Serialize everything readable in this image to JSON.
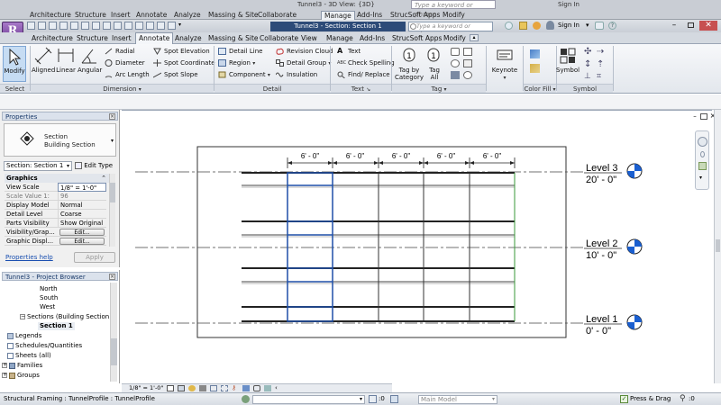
{
  "ghost": {
    "tabs": [
      "Architecture",
      "Structure",
      "Insert",
      "Annotate",
      "Analyze",
      "Massing & Site",
      "Collaborate",
      "Manage",
      "Add-Ins",
      "StrucSoft Apps",
      "Modify"
    ],
    "active_tab": "Manage",
    "title": "Tunnel3 - 3D View: {3D}",
    "search_placeholder": "Type a keyword or phrase",
    "sign_in": "Sign In"
  },
  "app": {
    "logo": "R",
    "title": "Tunnel3 - Section: Section 1",
    "search_placeholder": "Type a keyword or phrase",
    "sign_in": "Sign In"
  },
  "ribbon_tabs": [
    "Architecture",
    "Structure",
    "Insert",
    "Annotate",
    "Analyze",
    "Massing & Site",
    "Collaborate",
    "View",
    "Manage",
    "Add-Ins",
    "StrucSoft Apps",
    "Modify"
  ],
  "active_ribbon_tab": "Annotate",
  "ribbon": {
    "modify": "Modify",
    "aligned": "Aligned",
    "linear": "Linear",
    "angular": "Angular",
    "radial": "Radial",
    "diameter": "Diameter",
    "arc_length": "Arc Length",
    "spot_elevation": "Spot Elevation",
    "spot_coordinate": "Spot Coordinate",
    "spot_slope": "Spot Slope",
    "detail_line": "Detail Line",
    "region": "Region",
    "component": "Component",
    "revision_cloud": "Revision Cloud",
    "detail_group": "Detail Group",
    "insulation": "Insulation",
    "text": "Text",
    "check_spelling": "Check Spelling",
    "find_replace": "Find/ Replace",
    "tag_by_category_1": "Tag by",
    "tag_by_category_2": "Category",
    "tag_all_1": "Tag",
    "tag_all_2": "All",
    "keynote": "Keynote",
    "symbol": "Symbol",
    "abc": "ABC"
  },
  "panel_labels": {
    "select": "Select",
    "dimension": "Dimension",
    "detail": "Detail",
    "text": "Text",
    "tag": "Tag",
    "color_fill": "Color Fill",
    "symbol": "Symbol"
  },
  "properties": {
    "title": "Properties",
    "type_name": "Section",
    "type_sub": "Building Section",
    "selector": "Section: Section 1",
    "edit_type": "Edit Type",
    "group": "Graphics",
    "rows": [
      {
        "k": "View Scale",
        "v": "1/8\" = 1'-0\""
      },
      {
        "k": "Scale Value   1:",
        "v": "96"
      },
      {
        "k": "Display Model",
        "v": "Normal"
      },
      {
        "k": "Detail Level",
        "v": "Coarse"
      },
      {
        "k": "Parts Visibility",
        "v": "Show Original"
      },
      {
        "k": "Visibility/Grap...",
        "v": "Edit..."
      },
      {
        "k": "Graphic Displ...",
        "v": "Edit..."
      }
    ],
    "help": "Properties help",
    "apply": "Apply"
  },
  "browser": {
    "title": "Tunnel3 - Project Browser",
    "items": [
      {
        "label": "North"
      },
      {
        "label": "South"
      },
      {
        "label": "West"
      },
      {
        "label": "Sections (Building Section)"
      },
      {
        "label": "Section 1"
      },
      {
        "label": "Legends"
      },
      {
        "label": "Schedules/Quantities"
      },
      {
        "label": "Sheets (all)"
      },
      {
        "label": "Families"
      },
      {
        "label": "Groups"
      }
    ]
  },
  "dimensions": [
    "6' - 0\"",
    "6' - 0\"",
    "6' - 0\"",
    "6' - 0\"",
    "6' - 0\""
  ],
  "levels": [
    {
      "name": "Level 3",
      "elev": "20' - 0\""
    },
    {
      "name": "Level 2",
      "elev": "10' - 0\""
    },
    {
      "name": "Level 1",
      "elev": "0' - 0\""
    }
  ],
  "viewbar": {
    "scale": "1/8\" = 1'-0\""
  },
  "status": {
    "text": "Structural Framing : TunnelProfile : TunnelProfile",
    "coord": ":0",
    "main_model": "Main Model",
    "press_drag": "Press & Drag",
    "filter": ":0"
  },
  "colors": {
    "accent": "#2d4b78",
    "selection_blue": "#1f4fa8",
    "ribbon_bg": "#e9ecf1"
  }
}
